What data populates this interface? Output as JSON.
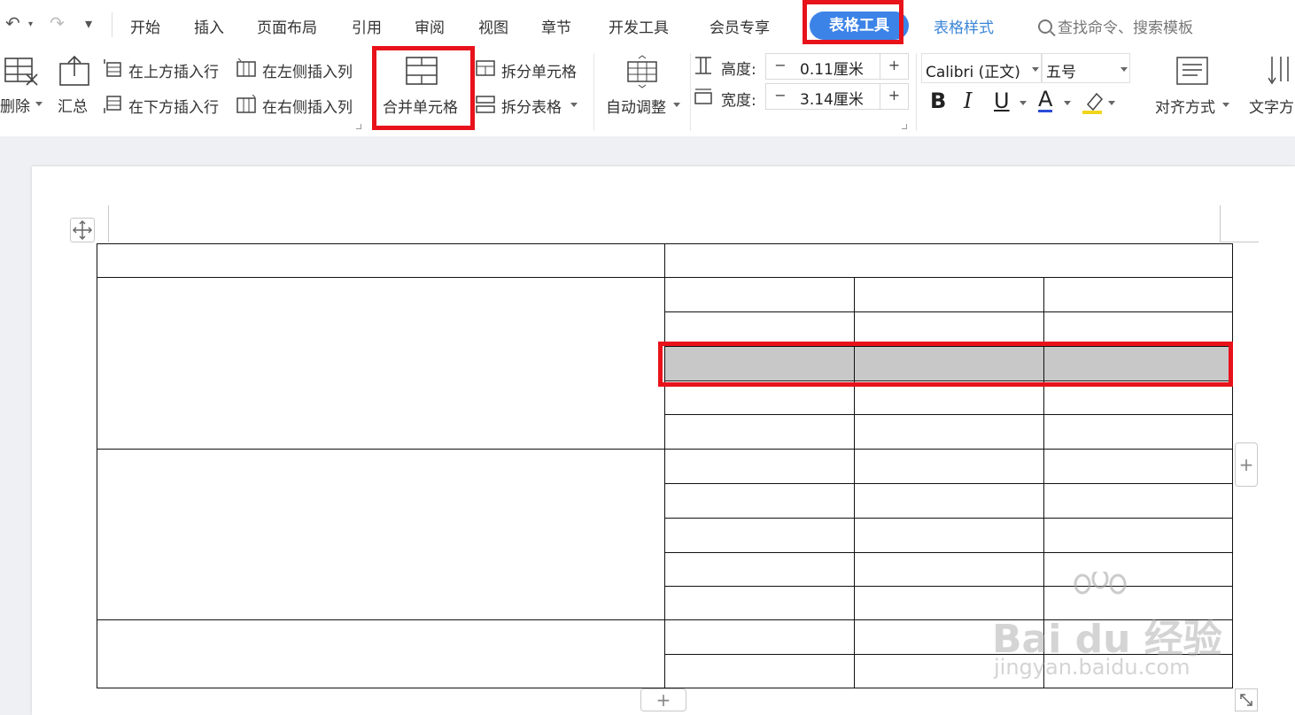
{
  "quick_access": {
    "undo": "↶",
    "redo": "↷",
    "customize": "▾"
  },
  "menu": {
    "tabs": [
      "开始",
      "插入",
      "页面布局",
      "引用",
      "审阅",
      "视图",
      "章节",
      "开发工具",
      "会员专享"
    ],
    "active_tab": "表格工具",
    "table_style_tab": "表格样式",
    "search": "查找命令、搜索模板"
  },
  "ribbon": {
    "delete": "删除",
    "summary": "汇总",
    "insert_row_above": "在上方插入行",
    "insert_row_below": "在下方插入行",
    "insert_col_left": "在左侧插入列",
    "insert_col_right": "在右侧插入列",
    "merge_cells": "合并单元格",
    "split_cells": "拆分单元格",
    "split_table": "拆分表格",
    "auto_fit": "自动调整",
    "height_label": "高度:",
    "height_value": "0.11厘米",
    "width_label": "宽度:",
    "width_value": "3.14厘米",
    "minus": "−",
    "plus": "+",
    "font_name": "Calibri (正文)",
    "font_size": "五号",
    "bold": "B",
    "italic": "I",
    "underline": "U",
    "font_color": "A",
    "align": "对齐方式",
    "text_direction": "文字方"
  },
  "document": {
    "add_row": "+",
    "add_col": "+"
  },
  "watermark": {
    "logo": "Bai du 经验",
    "url": "jingyan.baidu.com"
  },
  "colors": {
    "accent": "#3c83e8",
    "highlight": "#e8121b",
    "selected_cell": "#c8c8c8"
  }
}
